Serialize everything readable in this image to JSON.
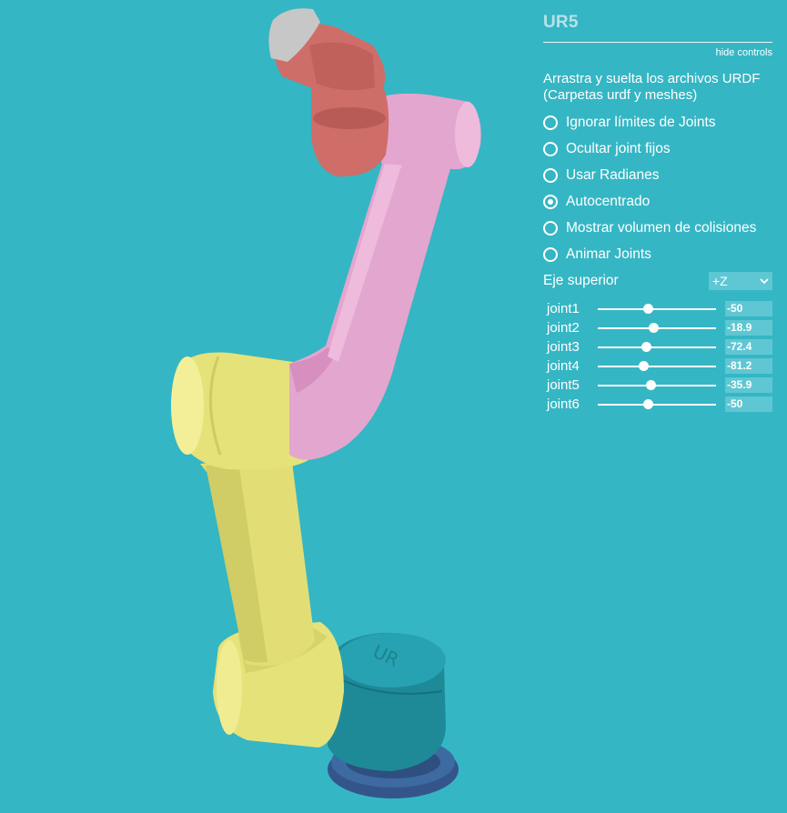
{
  "title": "UR5",
  "hide_controls": "hide controls",
  "drop_text_1": "Arrastra y suelta los archivos URDF",
  "drop_text_2": "(Carpetas urdf y meshes)",
  "options": [
    {
      "label": "Ignorar límites de Joints",
      "checked": false
    },
    {
      "label": "Ocultar joint fijos",
      "checked": false
    },
    {
      "label": "Usar Radianes",
      "checked": false
    },
    {
      "label": "Autocentrado",
      "checked": true
    },
    {
      "label": "Mostrar volumen de colisiones",
      "checked": false
    },
    {
      "label": "Animar Joints",
      "checked": false
    }
  ],
  "up_axis": {
    "label": "Eje superior",
    "value": "+Z",
    "icon": "chevron-down-icon"
  },
  "joints": [
    {
      "name": "joint1",
      "value": "-50",
      "fraction": 0.43
    },
    {
      "name": "joint2",
      "value": "-18.9",
      "fraction": 0.47
    },
    {
      "name": "joint3",
      "value": "-72.4",
      "fraction": 0.41
    },
    {
      "name": "joint4",
      "value": "-81.2",
      "fraction": 0.39
    },
    {
      "name": "joint5",
      "value": "-35.9",
      "fraction": 0.45
    },
    {
      "name": "joint6",
      "value": "-50",
      "fraction": 0.43
    }
  ],
  "colors": {
    "background": "#35b6c4",
    "link_base": "#1e8a98",
    "link_shoulder": "#e6e27a",
    "link_upper": "#e6e27a",
    "link_forearm": "#e3a6cf",
    "link_wrist": "#cf6d68",
    "link_tool": "#c7c7c7"
  }
}
